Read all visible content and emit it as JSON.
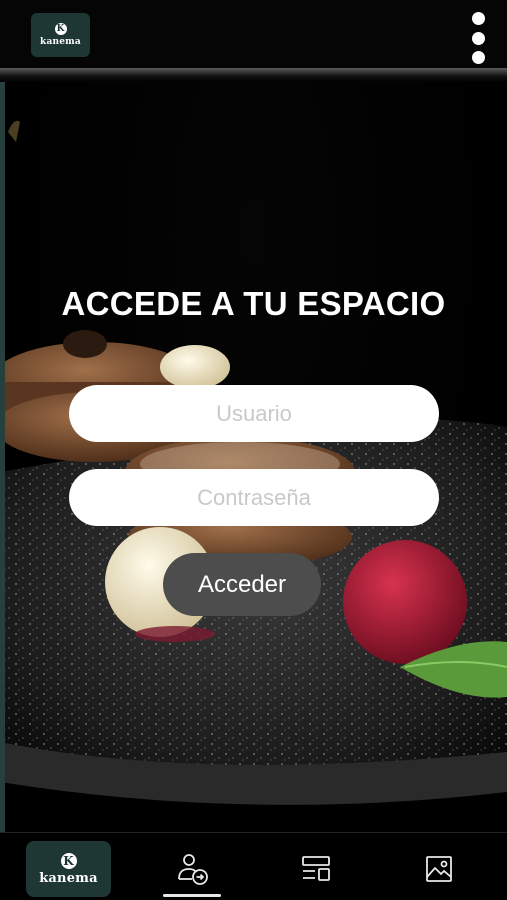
{
  "app": {
    "logo_text": "kanema",
    "logo_letter": "K"
  },
  "header": {
    "menu_icon": "more-vertical-icon"
  },
  "hero": {
    "title": "ACCEDE A TU ESPACIO"
  },
  "login_form": {
    "username_placeholder": "Usuario",
    "username_value": "",
    "password_placeholder": "Contraseña",
    "password_value": "",
    "submit_label": "Acceder"
  },
  "bottom_nav": {
    "items": [
      {
        "id": "home",
        "icon": "kanema-logo"
      },
      {
        "id": "login",
        "icon": "user-login-icon",
        "active": true
      },
      {
        "id": "menu",
        "icon": "layout-icon"
      },
      {
        "id": "gallery",
        "icon": "image-icon"
      }
    ]
  },
  "colors": {
    "brand": "#1e3634",
    "button": "#4d4d4d",
    "background": "#000000"
  }
}
